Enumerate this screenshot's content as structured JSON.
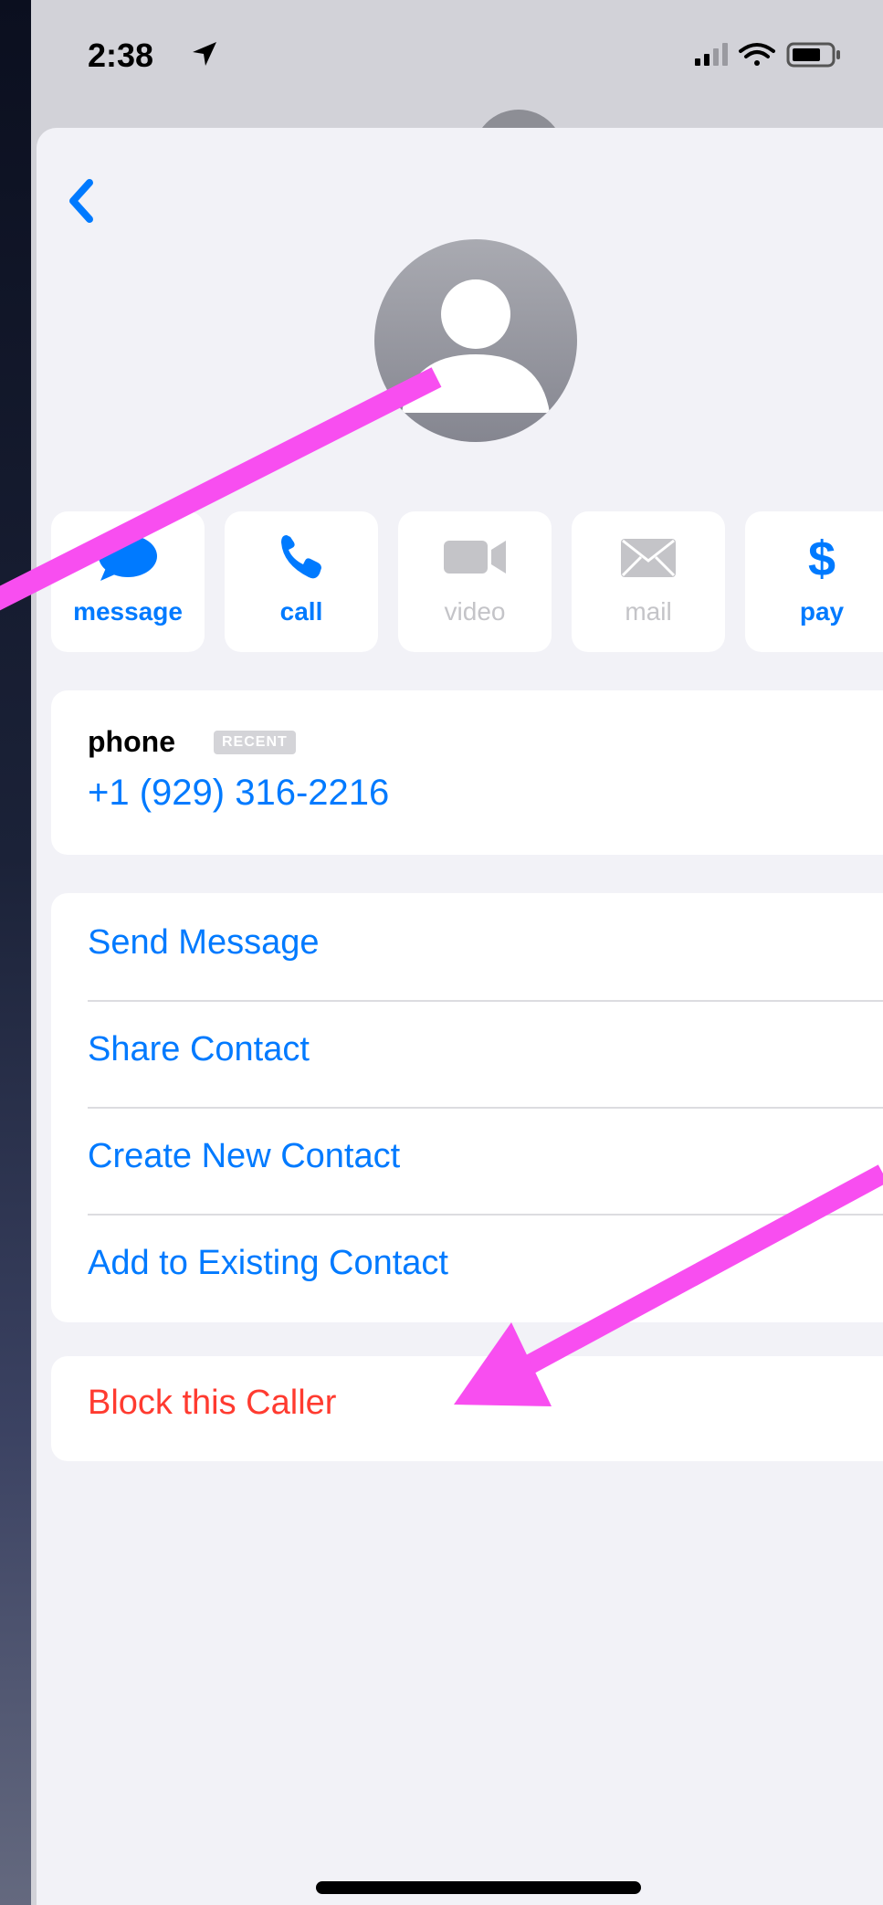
{
  "status_bar": {
    "time": "2:38",
    "location_icon": "location-arrow-icon",
    "signal_icon": "cellular-signal-icon",
    "wifi_icon": "wifi-icon",
    "battery_icon": "battery-icon"
  },
  "nav": {
    "back_icon": "chevron-left-icon"
  },
  "avatar": {
    "icon": "person-silhouette-icon"
  },
  "actions": [
    {
      "label": "message",
      "icon": "message-bubble-icon",
      "enabled": true
    },
    {
      "label": "call",
      "icon": "phone-icon",
      "enabled": true
    },
    {
      "label": "video",
      "icon": "video-camera-icon",
      "enabled": false
    },
    {
      "label": "mail",
      "icon": "envelope-icon",
      "enabled": false
    },
    {
      "label": "pay",
      "icon": "dollar-icon",
      "enabled": true
    }
  ],
  "phone": {
    "label": "phone",
    "badge": "RECENT",
    "number": "+1 (929) 316-2216"
  },
  "options": [
    "Send Message",
    "Share Contact",
    "Create New Contact",
    "Add to Existing Contact"
  ],
  "block_label": "Block this Caller",
  "colors": {
    "accent": "#007aff",
    "destructive": "#ff3b30",
    "annotation": "#f84ef0",
    "background": "#f2f2f7"
  }
}
